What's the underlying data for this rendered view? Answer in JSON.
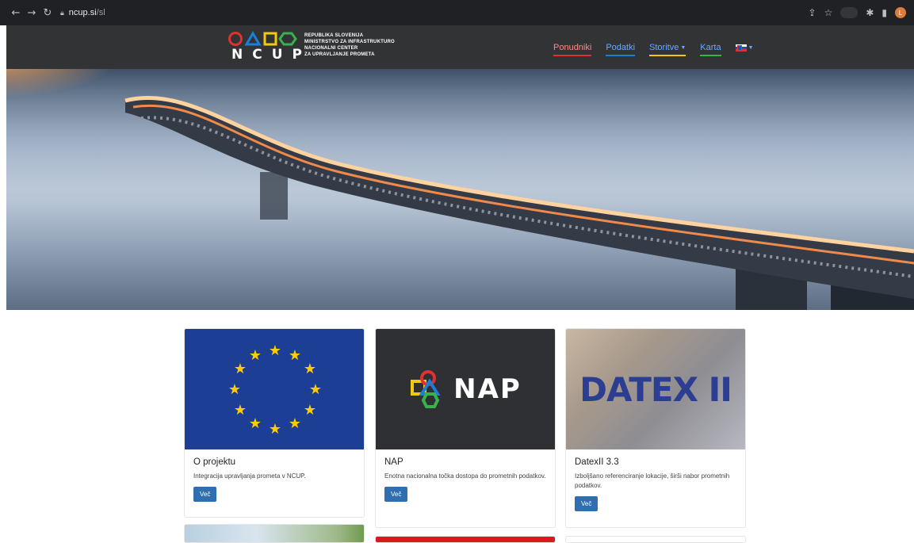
{
  "browser": {
    "url_host": "ncup.si",
    "url_path": "/sl",
    "profile_initial": "L"
  },
  "header": {
    "logo_word": "NCUP",
    "logo_lines": [
      "REPUBLIKA SLOVENIJA",
      "MINISTRSTVO ZA INFRASTRUKTURO",
      "NACIONALNI CENTER",
      "ZA UPRAVLJANJE PROMETA"
    ],
    "nav": [
      {
        "label": "Ponudniki",
        "accent": "#e03131"
      },
      {
        "label": "Podatki",
        "accent": "#1c7ed6"
      },
      {
        "label": "Storitve",
        "accent": "#f2c811"
      },
      {
        "label": "Karta",
        "accent": "#37b24d"
      }
    ],
    "language_flag": "slovenia-flag-icon"
  },
  "hero": {
    "image": "bridge-over-fog"
  },
  "cards": [
    {
      "title": "O projektu",
      "text": "Integracija upravljanja prometa v NCUP.",
      "button": "Več",
      "image": "eu-flag"
    },
    {
      "title": "NAP",
      "text": "Enotna nacionalna točka dostopa do prometnih podatkov.",
      "button": "Več",
      "image": "nap-logo",
      "image_label": "NAP"
    },
    {
      "title": "DatexII 3.3",
      "text": "Izboljšano referenciranje lokacije, širši nabor prometnih podatkov.",
      "button": "Več",
      "image": "datex-logo",
      "image_label": "DATEX II"
    }
  ],
  "colors": {
    "header_bg": "#313335",
    "button_bg": "#2f6fb0",
    "eu_blue": "#1c3e94",
    "nap_bg": "#2f3033",
    "datex_blue": "#2c3e91"
  }
}
